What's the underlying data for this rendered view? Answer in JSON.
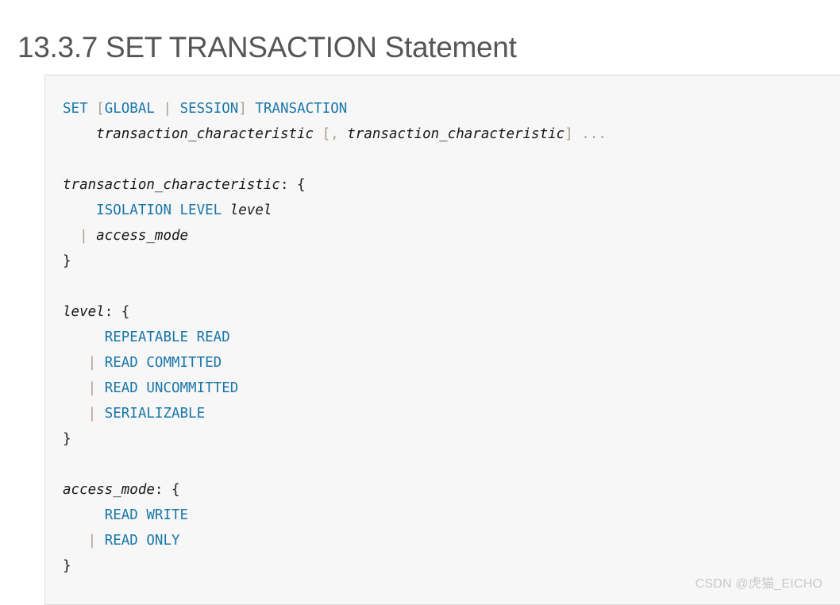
{
  "page": {
    "title": "13.3.7 SET TRANSACTION Statement",
    "watermark": "CSDN @虎猫_EICHO"
  },
  "colors": {
    "page_background": "#ffffff",
    "title_text": "#565656",
    "code_background": "#f7f7f7",
    "code_border": "#dddddd",
    "keyword": "#1a76a8",
    "placeholder": "#161616",
    "punctuation": "#1a1a1a",
    "operator": "#ab9e90",
    "watermark_text": "#c9c9c9"
  },
  "code": {
    "language": "sql",
    "full_text": "SET [GLOBAL | SESSION] TRANSACTION\n    transaction_characteristic [, transaction_characteristic] ...\n\ntransaction_characteristic: {\n    ISOLATION LEVEL level\n  | access_mode\n}\n\nlevel: {\n     REPEATABLE READ\n   | READ COMMITTED\n   | READ UNCOMMITTED\n   | SERIALIZABLE\n}\n\naccess_mode: {\n     READ WRITE\n   | READ ONLY\n}",
    "lines": [
      {
        "id": "line-1",
        "text": "SET [GLOBAL | SESSION] TRANSACTION"
      },
      {
        "id": "line-2",
        "text": "    transaction_characteristic [, transaction_characteristic] ..."
      },
      {
        "id": "line-3",
        "text": ""
      },
      {
        "id": "line-4",
        "text": "transaction_characteristic: {"
      },
      {
        "id": "line-5",
        "text": "    ISOLATION LEVEL level"
      },
      {
        "id": "line-6",
        "text": "  | access_mode"
      },
      {
        "id": "line-7",
        "text": "}"
      },
      {
        "id": "line-8",
        "text": ""
      },
      {
        "id": "line-9",
        "text": "level: {"
      },
      {
        "id": "line-10",
        "text": "     REPEATABLE READ"
      },
      {
        "id": "line-11",
        "text": "   | READ COMMITTED"
      },
      {
        "id": "line-12",
        "text": "   | READ UNCOMMITTED"
      },
      {
        "id": "line-13",
        "text": "   | SERIALIZABLE"
      },
      {
        "id": "line-14",
        "text": "}"
      },
      {
        "id": "line-15",
        "text": ""
      },
      {
        "id": "line-16",
        "text": "access_mode: {"
      },
      {
        "id": "line-17",
        "text": "     READ WRITE"
      },
      {
        "id": "line-18",
        "text": "   | READ ONLY"
      },
      {
        "id": "line-19",
        "text": "}"
      }
    ],
    "tokens": {
      "set": "SET",
      "global": "GLOBAL",
      "session": "SESSION",
      "transaction": "TRANSACTION",
      "transaction_characteristic": "transaction_characteristic",
      "isolation_level": "ISOLATION LEVEL",
      "level": "level",
      "access_mode": "access_mode",
      "repeatable_read": "REPEATABLE READ",
      "read_committed": "READ COMMITTED",
      "read_uncommitted": "READ UNCOMMITTED",
      "serializable": "SERIALIZABLE",
      "read_write": "READ WRITE",
      "read_only": "READ ONLY",
      "bracket_open": "[",
      "bracket_close": "]",
      "bracket_open_comma": "[,",
      "pipe": "|",
      "ellipsis": "...",
      "brace_open": "{",
      "brace_close": "}",
      "colon": ":",
      "colon_brace": ": {",
      "space": " ",
      "indent2": "  ",
      "indent3": "   ",
      "indent4": "    ",
      "indent5": "     "
    }
  }
}
